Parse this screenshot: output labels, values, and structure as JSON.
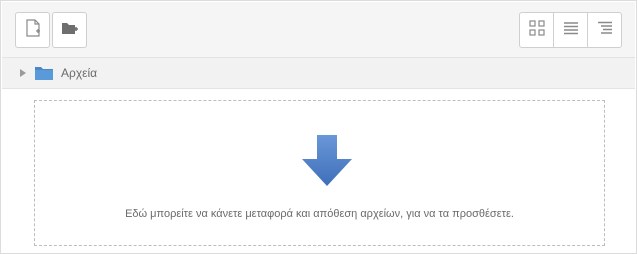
{
  "toolbar": {
    "left_buttons": [
      {
        "icon": "new-file-icon"
      },
      {
        "icon": "new-folder-icon"
      }
    ],
    "view_buttons": [
      {
        "icon": "view-icons-icon"
      },
      {
        "icon": "view-list-icon"
      },
      {
        "icon": "view-tree-icon"
      }
    ]
  },
  "path": {
    "folder_label": "Αρχεία",
    "folder_color": "#4a86c8"
  },
  "dropzone": {
    "message": "Εδώ μπορείτε να κάνετε μεταφορά και απόθεση αρχείων, για να τα προσθέσετε.",
    "arrow_color": "#4d7fcb"
  }
}
